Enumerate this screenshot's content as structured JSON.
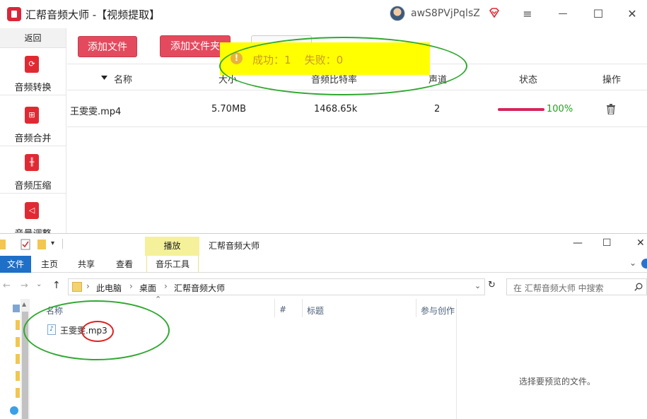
{
  "app": {
    "title": "汇帮音频大师 -【视频提取】",
    "username": "awS8PVjPqlsZ",
    "window_controls": {
      "menu": "≡",
      "minimize": "—",
      "maximize": "☐",
      "close": "✕"
    }
  },
  "sidebar": {
    "back_label": "返回",
    "items": [
      {
        "label": "音频转换",
        "icon": "audio-convert-icon"
      },
      {
        "label": "音频合并",
        "icon": "audio-merge-icon"
      },
      {
        "label": "音频压缩",
        "icon": "audio-compress-icon"
      },
      {
        "label": "音量调整",
        "icon": "volume-adjust-icon"
      }
    ]
  },
  "toolbar": {
    "add_file_label": "添加文件",
    "add_folder_label": "添加文件夹"
  },
  "toast": {
    "text": "成功：1    失败：0",
    "icon": "!"
  },
  "table": {
    "columns": [
      "名称",
      "大小",
      "音频比特率",
      "声道",
      "状态",
      "操作"
    ],
    "rows": [
      {
        "name": "王雯雯.mp4",
        "size": "5.70MB",
        "bitrate": "1468.65k",
        "channels": "2",
        "status": "100%",
        "progress": 1.0
      }
    ]
  },
  "explorer": {
    "title": "汇帮音频大师",
    "ribbon_tabs": [
      "文件",
      "主页",
      "共享",
      "查看",
      "音乐工具"
    ],
    "ribbon_context": "播放",
    "breadcrumb": [
      "此电脑",
      "桌面",
      "汇帮音频大师"
    ],
    "search_placeholder": "在 汇帮音频大师 中搜索",
    "columns": [
      "名称",
      "#",
      "标题",
      "参与创作"
    ],
    "files": [
      {
        "name": "王雯雯.mp3"
      }
    ],
    "preview_text": "选择要预览的文件。"
  },
  "colors": {
    "accent": "#e44a5e",
    "progress": "#d6245a",
    "status_text": "#22a022",
    "toast_bg": "#ffff00",
    "annotation_green": "#2fa82f",
    "annotation_red": "#e02020",
    "explorer_file_tab": "#1e6fc7"
  }
}
